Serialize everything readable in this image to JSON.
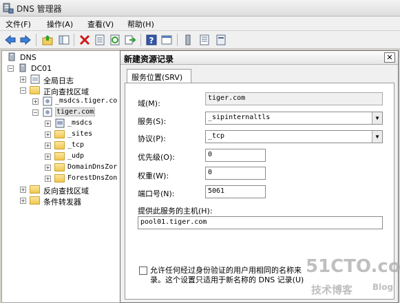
{
  "window": {
    "title": "DNS 管理器"
  },
  "menu": [
    "文件(F)",
    "操作(A)",
    "查看(V)",
    "帮助(H)"
  ],
  "toolbar": [
    "back-icon",
    "forward-icon",
    "up-folder-icon",
    "show-hide-tree-icon",
    "delete-icon",
    "properties-icon",
    "refresh-icon",
    "export-icon",
    "help-icon",
    "console-icon",
    "server-icon",
    "list-icon",
    "record-icon"
  ],
  "tree": {
    "root": "DNS",
    "server": "DC01",
    "global_logs": "全局日志",
    "forward_zones": "正向查找区域",
    "msdcs_zone": "_msdcs.tiger.co",
    "tiger_zone": "tiger.com",
    "sub": [
      "_msdcs",
      "_sites",
      "_tcp",
      "_udp",
      "DomainDnsZor",
      "ForestDnsZon"
    ],
    "reverse_zones": "反向查找区域",
    "conditional_forwarders": "条件转发器"
  },
  "dialog": {
    "title": "新建资源记录",
    "close": "✕",
    "tab": "服务位置(SRV)",
    "domain_label": "域(M):",
    "domain_value": "tiger.com",
    "service_label": "服务(S):",
    "service_value": "_sipinternaltls",
    "protocol_label": "协议(P):",
    "protocol_value": "_tcp",
    "priority_label": "优先级(O):",
    "priority_value": "0",
    "weight_label": "权重(W):",
    "weight_value": "0",
    "port_label": "端口号(N):",
    "port_value": "5061",
    "host_label": "提供此服务的主机(H):",
    "host_value": "pool01.tiger.com",
    "checkbox_line1": "允许任何经过身份验证的用户用相同的名称来",
    "checkbox_line2": "录。这个设置只适用于新名称的 DNS 记录(U)"
  },
  "watermark": {
    "site": "51CTO.com",
    "sub": "技术博客",
    "blog": "Blog"
  }
}
